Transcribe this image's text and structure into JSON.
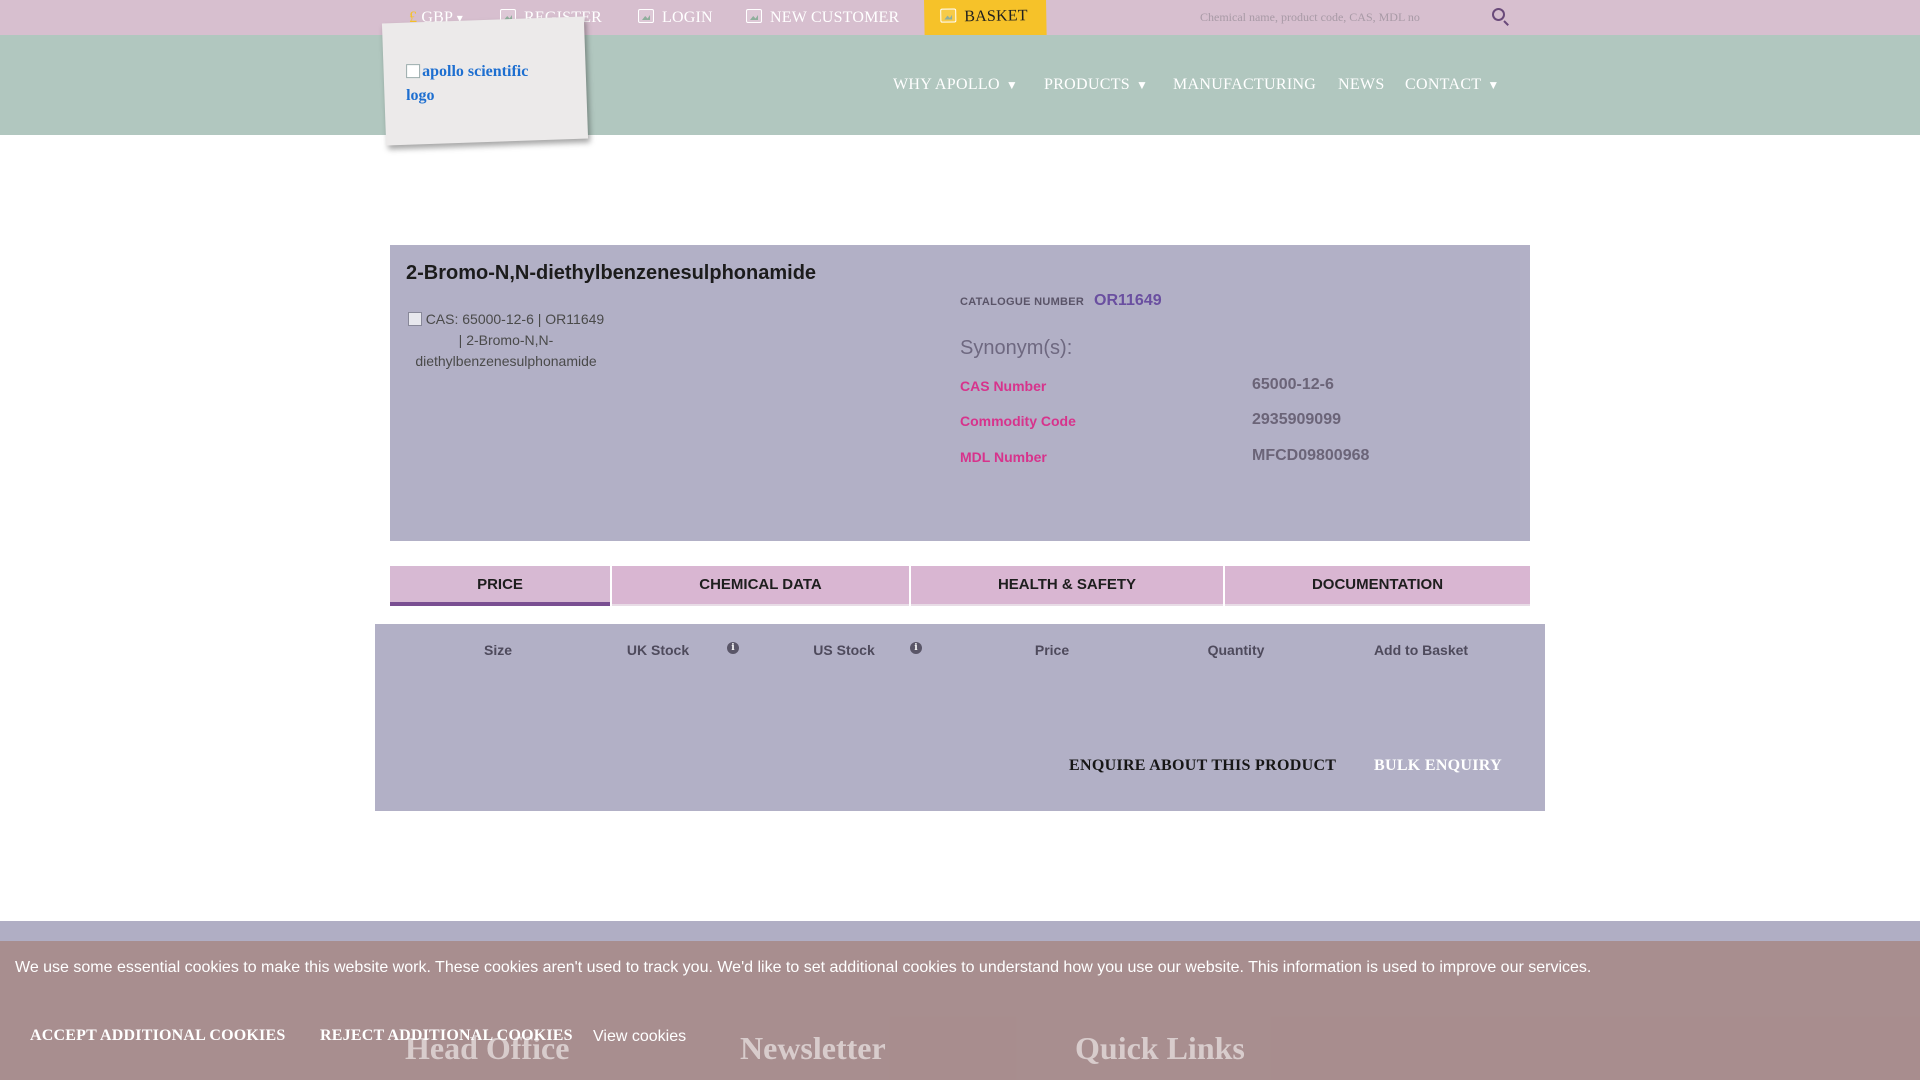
{
  "topbar": {
    "currency_symbol": "£",
    "currency": "GBP",
    "currency_caret": "▾",
    "register": "REGISTER",
    "login": "LOGIN",
    "new_customer": "NEW CUSTOMER",
    "basket": "BASKET",
    "search_placeholder": "Chemical name, product code, CAS, MDL no"
  },
  "header": {
    "logo_alt": "apollo scientific logo",
    "nav": [
      "WHY APOLLO",
      "PRODUCTS",
      "MANUFACTURING",
      "NEWS",
      "CONTACT"
    ],
    "caret": "▼"
  },
  "product": {
    "name": "2-Bromo-N,N-diethylbenzenesulphonamide",
    "image_alt": "CAS: 65000-12-6 | OR11649 | 2-Bromo-N,N-diethylbenzenesulphonamide",
    "catalogue_label": "CATALOGUE NUMBER",
    "catalogue_number": "OR11649",
    "synonyms_label": "Synonym(s):",
    "properties": [
      {
        "key": "CAS Number",
        "value": "65000-12-6"
      },
      {
        "key": "Commodity Code",
        "value": "2935909099"
      },
      {
        "key": "MDL Number",
        "value": "MFCD09800968"
      }
    ]
  },
  "tabs": [
    "PRICE",
    "CHEMICAL DATA",
    "HEALTH & SAFETY",
    "DOCUMENTATION"
  ],
  "price_table": {
    "headers": [
      "Size",
      "UK Stock",
      "US Stock",
      "Price",
      "Quantity",
      "Add to Basket"
    ],
    "info_glyph": "i",
    "enquire": "ENQUIRE ABOUT THIS PRODUCT",
    "bulk": "BULK ENQUIRY"
  },
  "footer": {
    "headings": [
      "Head Office",
      "Newsletter",
      "Quick Links"
    ]
  },
  "cookie": {
    "message": "We use some essential cookies to make this website work. These cookies aren't used to track you. We'd like to set additional cookies to understand how you use our website. This information is used to improve our services.",
    "accept": "ACCEPT ADDITIONAL COOKIES",
    "reject": "REJECT ADDITIONAL COOKIES",
    "view": "View cookies"
  },
  "colors": {
    "topbar": "#d7bfcf",
    "nav": "#b1c7bf",
    "panel": "#b2b0c6",
    "tab": "#d9b6d2",
    "accent_pink": "#d7338c",
    "basket": "#f6c229",
    "cookie": "#a88c8c"
  }
}
